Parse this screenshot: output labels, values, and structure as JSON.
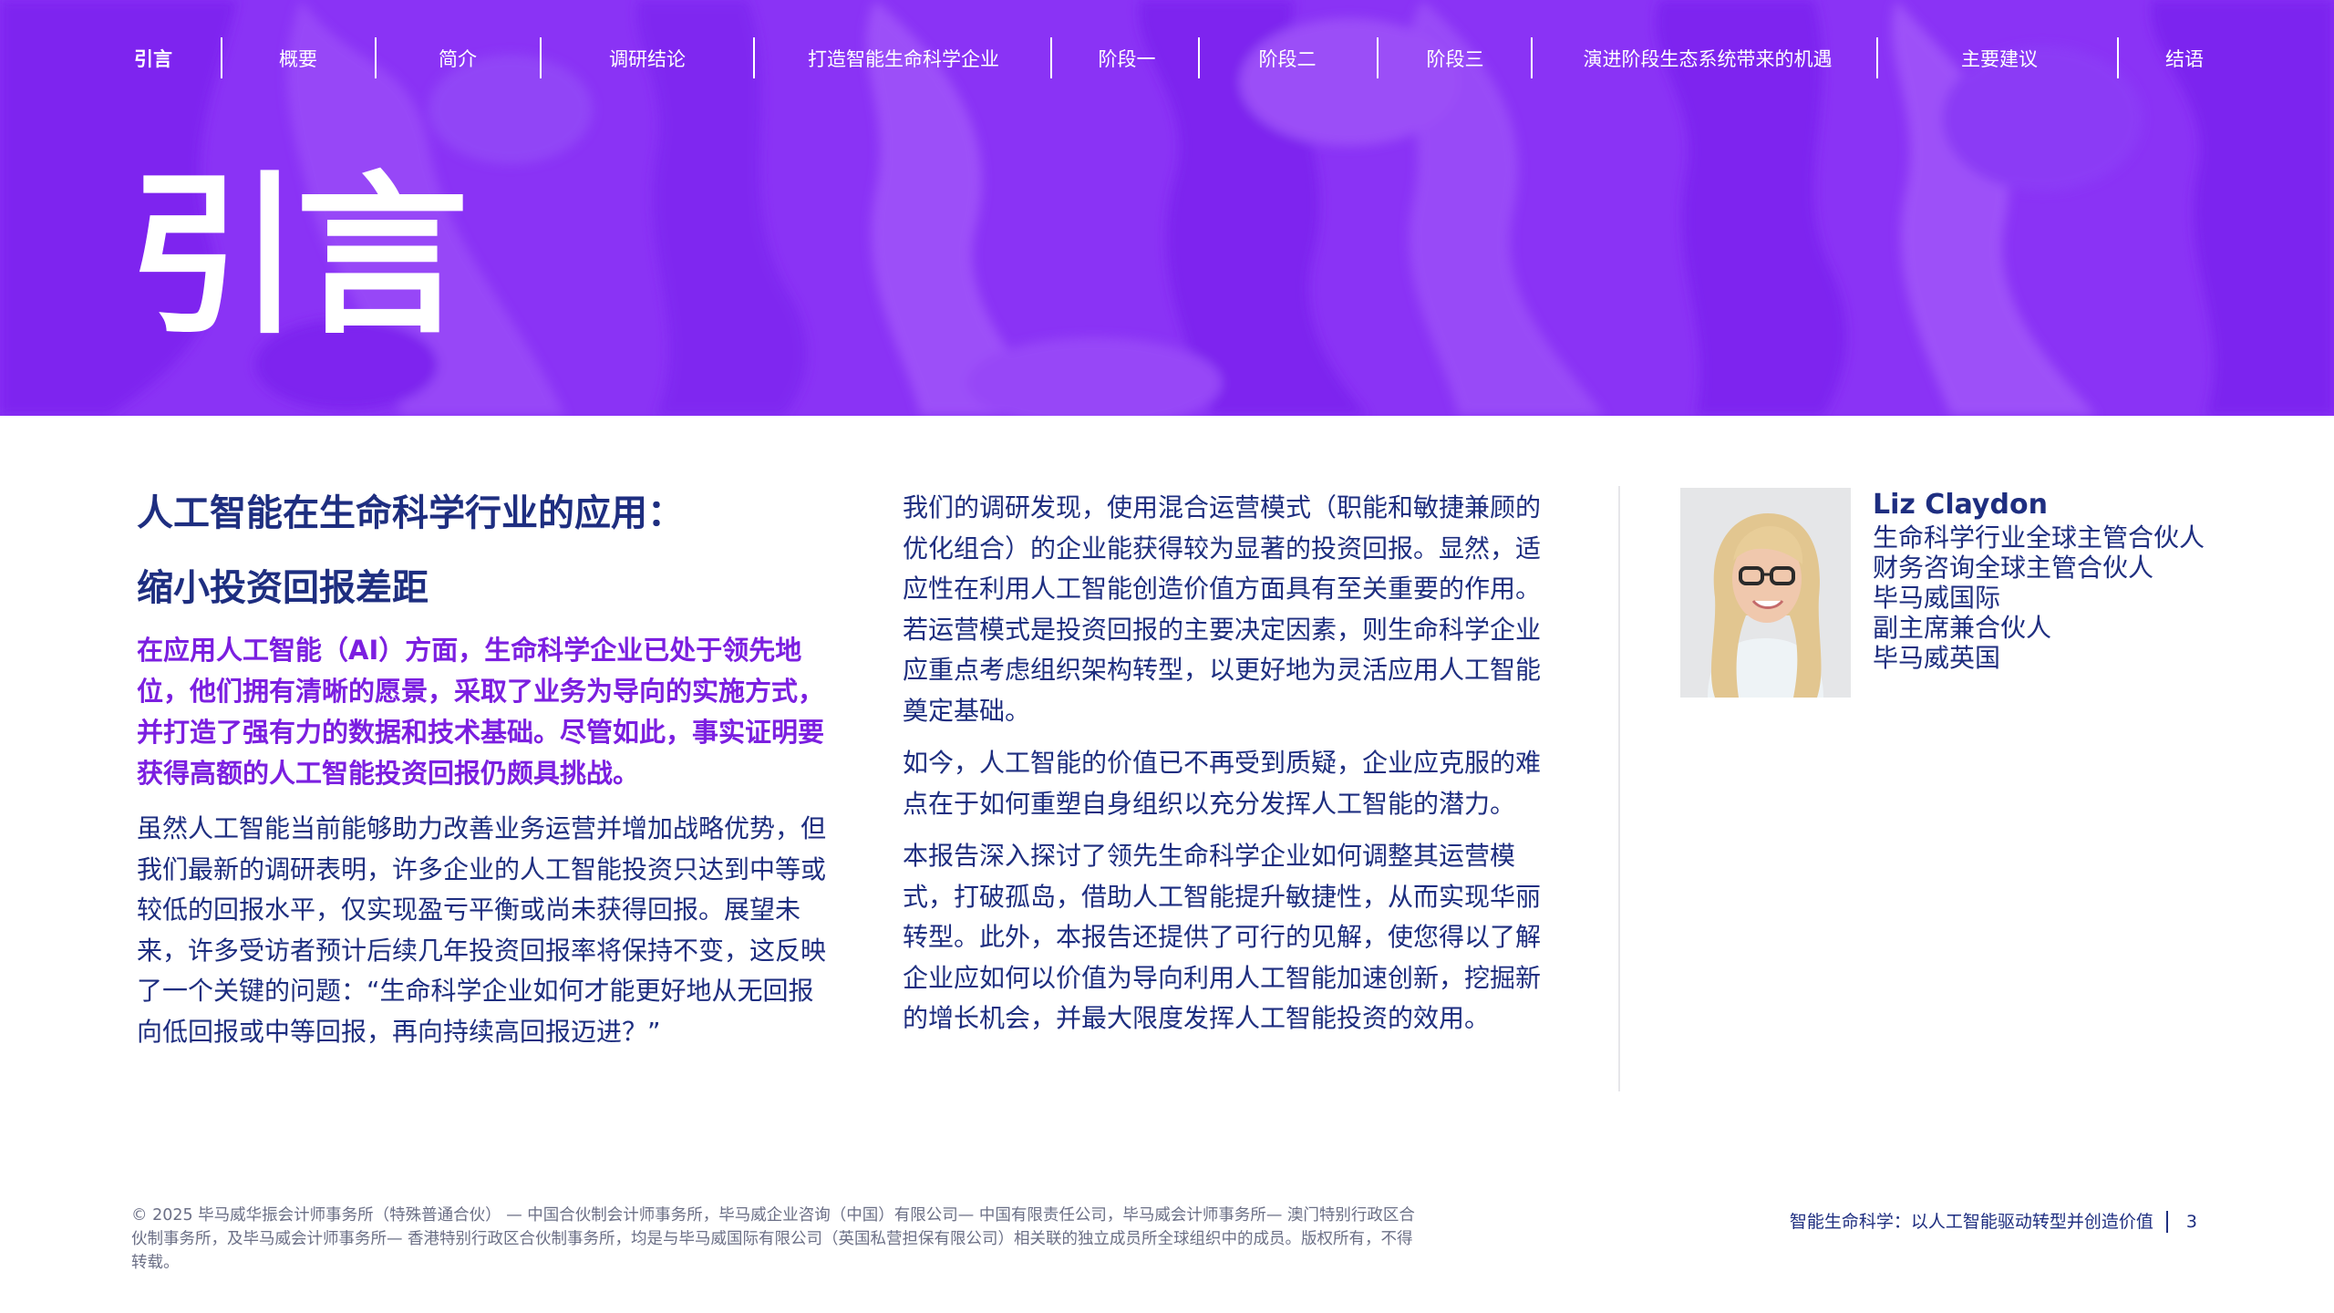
{
  "nav": {
    "items": [
      {
        "label": "引言",
        "active": true
      },
      {
        "label": "概要"
      },
      {
        "label": "简介"
      },
      {
        "label": "调研结论"
      },
      {
        "label": "打造智能生命科学企业"
      },
      {
        "label": "阶段一"
      },
      {
        "label": "阶段二"
      },
      {
        "label": "阶段三"
      },
      {
        "label": "演进阶段生态系统带来的机遇"
      },
      {
        "label": "主要建议"
      },
      {
        "label": "结语"
      }
    ]
  },
  "hero": {
    "title": "引言",
    "colors": {
      "background": "#8a33f5",
      "text": "#ffffff"
    }
  },
  "article": {
    "heading_line1": "人工智能在生命科学行业的应用：",
    "heading_line2": "缩小投资回报差距",
    "lead": "在应用人工智能（AI）方面，生命科学企业已处于领先地位，他们拥有清晰的愿景，采取了业务为导向的实施方式，并打造了强有力的数据和技术基础。尽管如此，事实证明要获得高额的人工智能投资回报仍颇具挑战。",
    "col1_p1": "虽然人工智能当前能够助力改善业务运营并增加战略优势，但我们最新的调研表明，许多企业的人工智能投资只达到中等或较低的回报水平，仅实现盈亏平衡或尚未获得回报。展望未来，许多受访者预计后续几年投资回报率将保持不变，这反映了一个关键的问题：“生命科学企业如何才能更好地从无回报向低回报或中等回报，再向持续高回报迈进？”",
    "col2_p1": "我们的调研发现，使用混合运营模式（职能和敏捷兼顾的优化组合）的企业能获得较为显著的投资回报。显然，适应性在利用人工智能创造价值方面具有至关重要的作用。若运营模式是投资回报的主要决定因素，则生命科学企业应重点考虑组织架构转型，以更好地为灵活应用人工智能奠定基础。",
    "col2_p2": "如今，人工智能的价值已不再受到质疑，企业应克服的难点在于如何重塑自身组织以充分发挥人工智能的潜力。",
    "col2_p3": "本报告深入探讨了领先生命科学企业如何调整其运营模式，打破孤岛，借助人工智能提升敏捷性，从而实现华丽转型。此外，本报告还提供了可行的见解，使您得以了解企业应如何以价值为导向利用人工智能加速创新，挖掘新的增长机会，并最大限度发挥人工智能投资的效用。",
    "colors": {
      "heading": "#1e2e80",
      "lead": "#7b1fe0",
      "body": "#1e2e80"
    }
  },
  "author": {
    "name": "Liz Claydon",
    "roles": [
      "生命科学行业全球主管合伙人",
      "财务咨询全球主管合伙人",
      "毕马威国际",
      "副主席兼合伙人",
      "毕马威英国"
    ]
  },
  "footer": {
    "legal": "© 2025 毕马威华振会计师事务所（特殊普通合伙） — 中国合伙制会计师事务所，毕马威企业咨询（中国）有限公司— 中国有限责任公司，毕马威会计师事务所— 澳门特别行政区合伙制事务所，及毕马威会计师事务所— 香港特别行政区合伙制事务所，均是与毕马威国际有限公司（英国私营担保有限公司）相关联的独立成员所全球组织中的成员。版权所有，不得转载。",
    "report_title": "智能生命科学：以人工智能驱动转型并创造价值",
    "page_number": "3"
  }
}
